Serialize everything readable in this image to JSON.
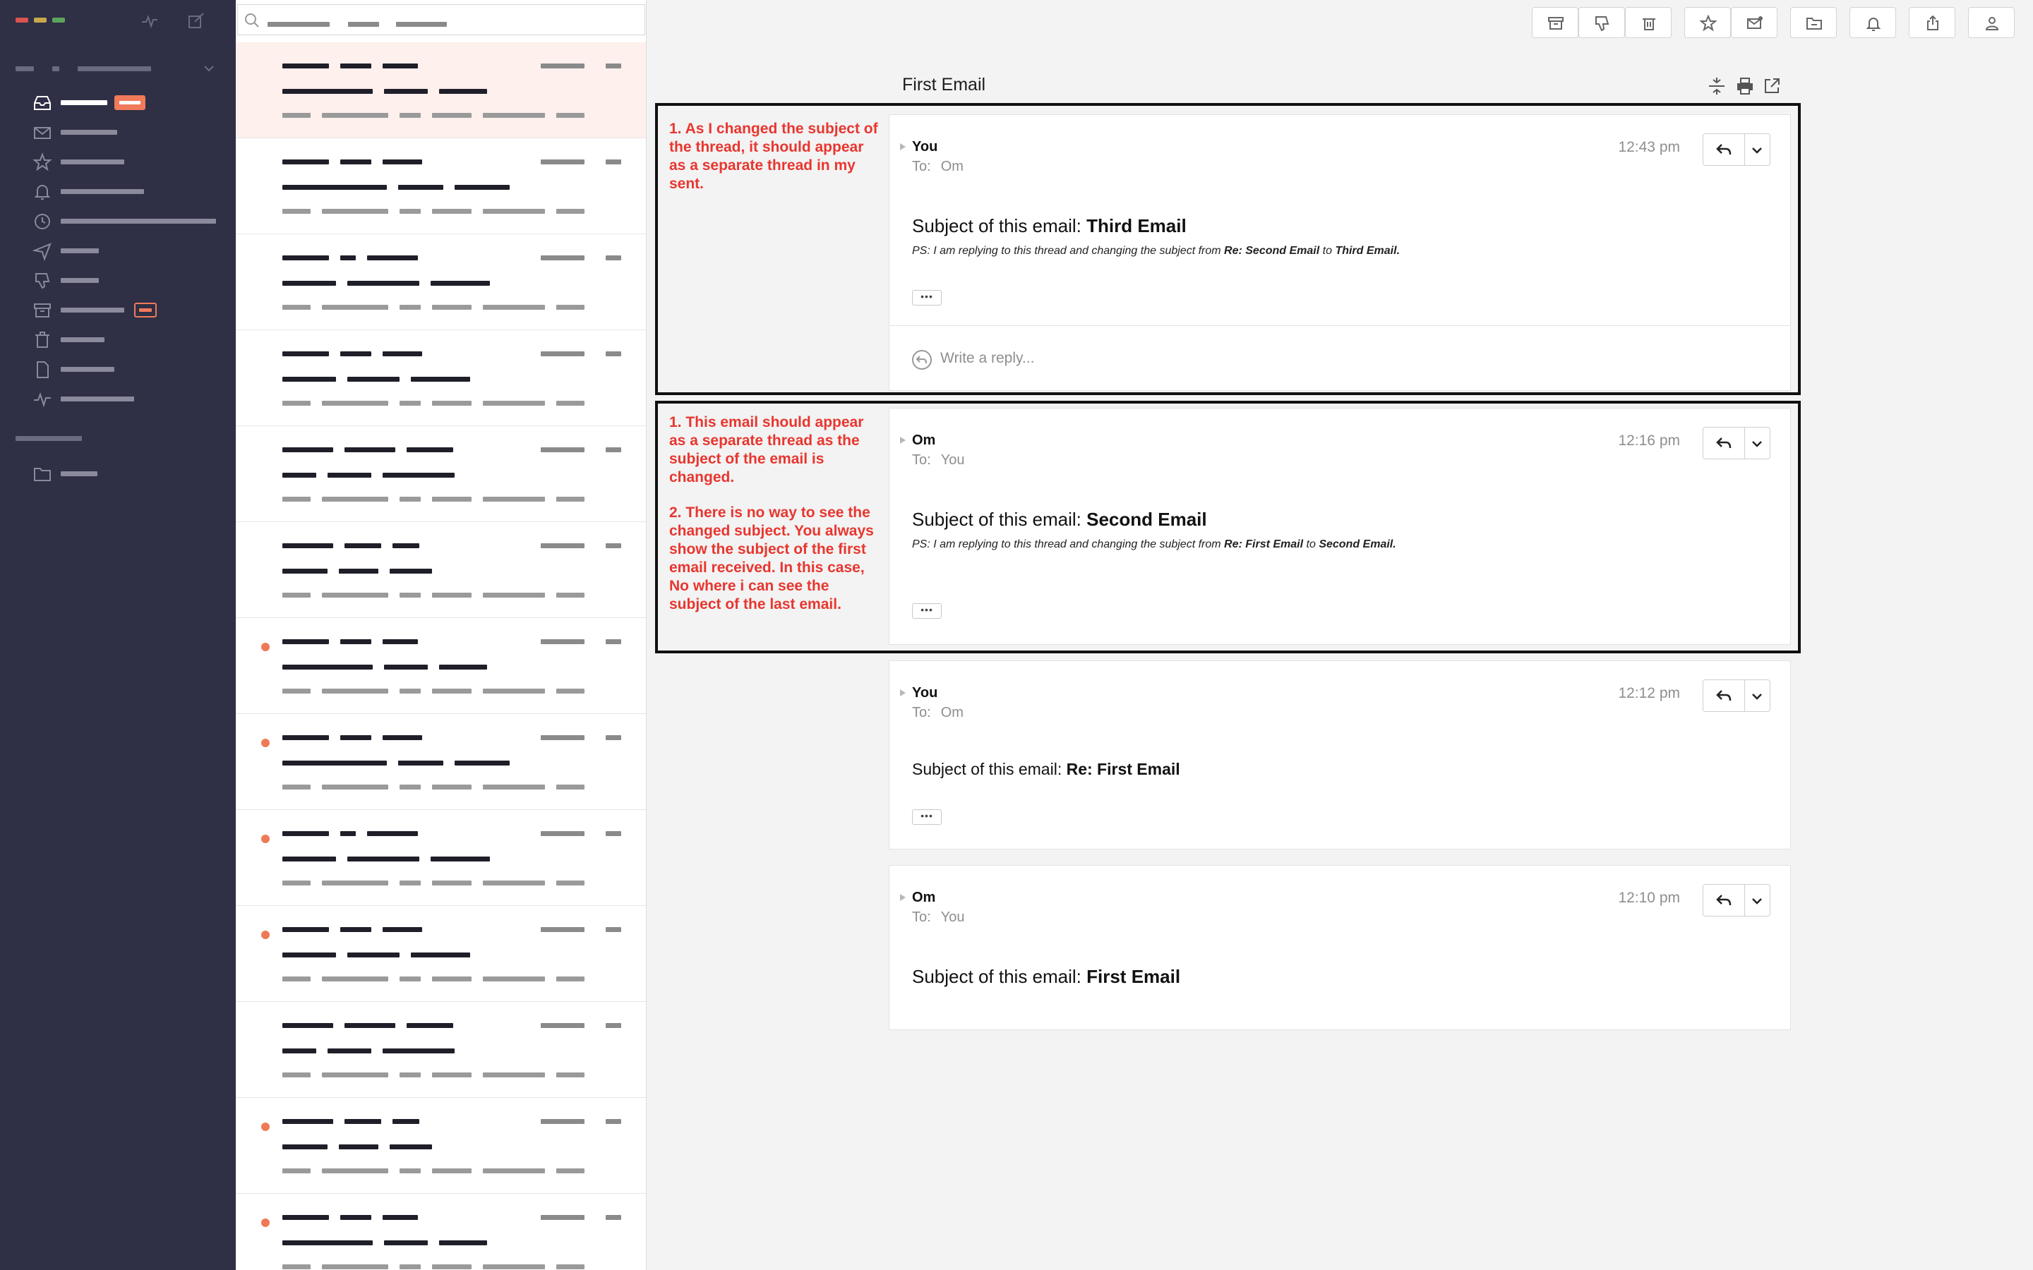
{
  "window": {
    "traffic_colors": [
      "#d9534f",
      "#c7a94a",
      "#5ba55b"
    ]
  },
  "sidebar": {
    "items": [
      {
        "icon": "inbox-icon",
        "active": true,
        "badge": "filled"
      },
      {
        "icon": "envelope-icon"
      },
      {
        "icon": "star-icon"
      },
      {
        "icon": "bell-icon"
      },
      {
        "icon": "clock-icon"
      },
      {
        "icon": "send-icon"
      },
      {
        "icon": "thumbs-down-icon"
      },
      {
        "icon": "archive-icon",
        "badge": "outline"
      },
      {
        "icon": "trash-icon"
      },
      {
        "icon": "document-icon"
      },
      {
        "icon": "activity-icon"
      }
    ],
    "folders": [
      {
        "icon": "folder-icon"
      }
    ]
  },
  "message_list": {
    "unread_rows": [
      6,
      7,
      8,
      9,
      11,
      12
    ]
  },
  "toolbar": {
    "buttons": [
      "archive-icon",
      "thumbs-down-icon",
      "trash-icon",
      "star-icon",
      "mark-unread-icon",
      "move-to-folder-icon",
      "bell-icon",
      "share-icon",
      "user-icon"
    ]
  },
  "thread": {
    "title": "First Email",
    "messages": [
      {
        "sender": "You",
        "to_label": "To:",
        "recipient": "Om",
        "time": "12:43 pm",
        "subject_prefix": "Subject of this email:",
        "subject": "Third Email",
        "ps_intro": "PS: I am replying to this thread and changing the subject from",
        "ps_from": "Re: Second Email",
        "ps_to_word": "to",
        "ps_to": "Third Email.",
        "reply_placeholder": "Write a reply..."
      },
      {
        "sender": "Om",
        "to_label": "To:",
        "recipient": "You",
        "time": "12:16 pm",
        "subject_prefix": "Subject of this email:",
        "subject": "Second Email",
        "ps_intro": "PS: I am replying to this thread and changing the subject from",
        "ps_from": "Re: First Email",
        "ps_to_word": "to",
        "ps_to": "Second Email."
      },
      {
        "sender": "You",
        "to_label": "To:",
        "recipient": "Om",
        "time": "12:12 pm",
        "subject_prefix": "Subject of this email:",
        "subject": "Re: First Email"
      },
      {
        "sender": "Om",
        "to_label": "To:",
        "recipient": "You",
        "time": "12:10 pm",
        "subject_prefix": "Subject of this email:",
        "subject": "First Email"
      }
    ],
    "more_label": "•••"
  },
  "annotations": {
    "note1": "1. As I changed the subject of the thread, it should appear as a separate thread in my sent.",
    "note2a": "1. This email should appear as a separate thread as the subject of the email is changed.",
    "note2b": "2. There is no way to see the changed subject. You always show the subject of the first email received. In this case, No where i can see the subject of the last email.",
    "color": "#e8362f"
  }
}
